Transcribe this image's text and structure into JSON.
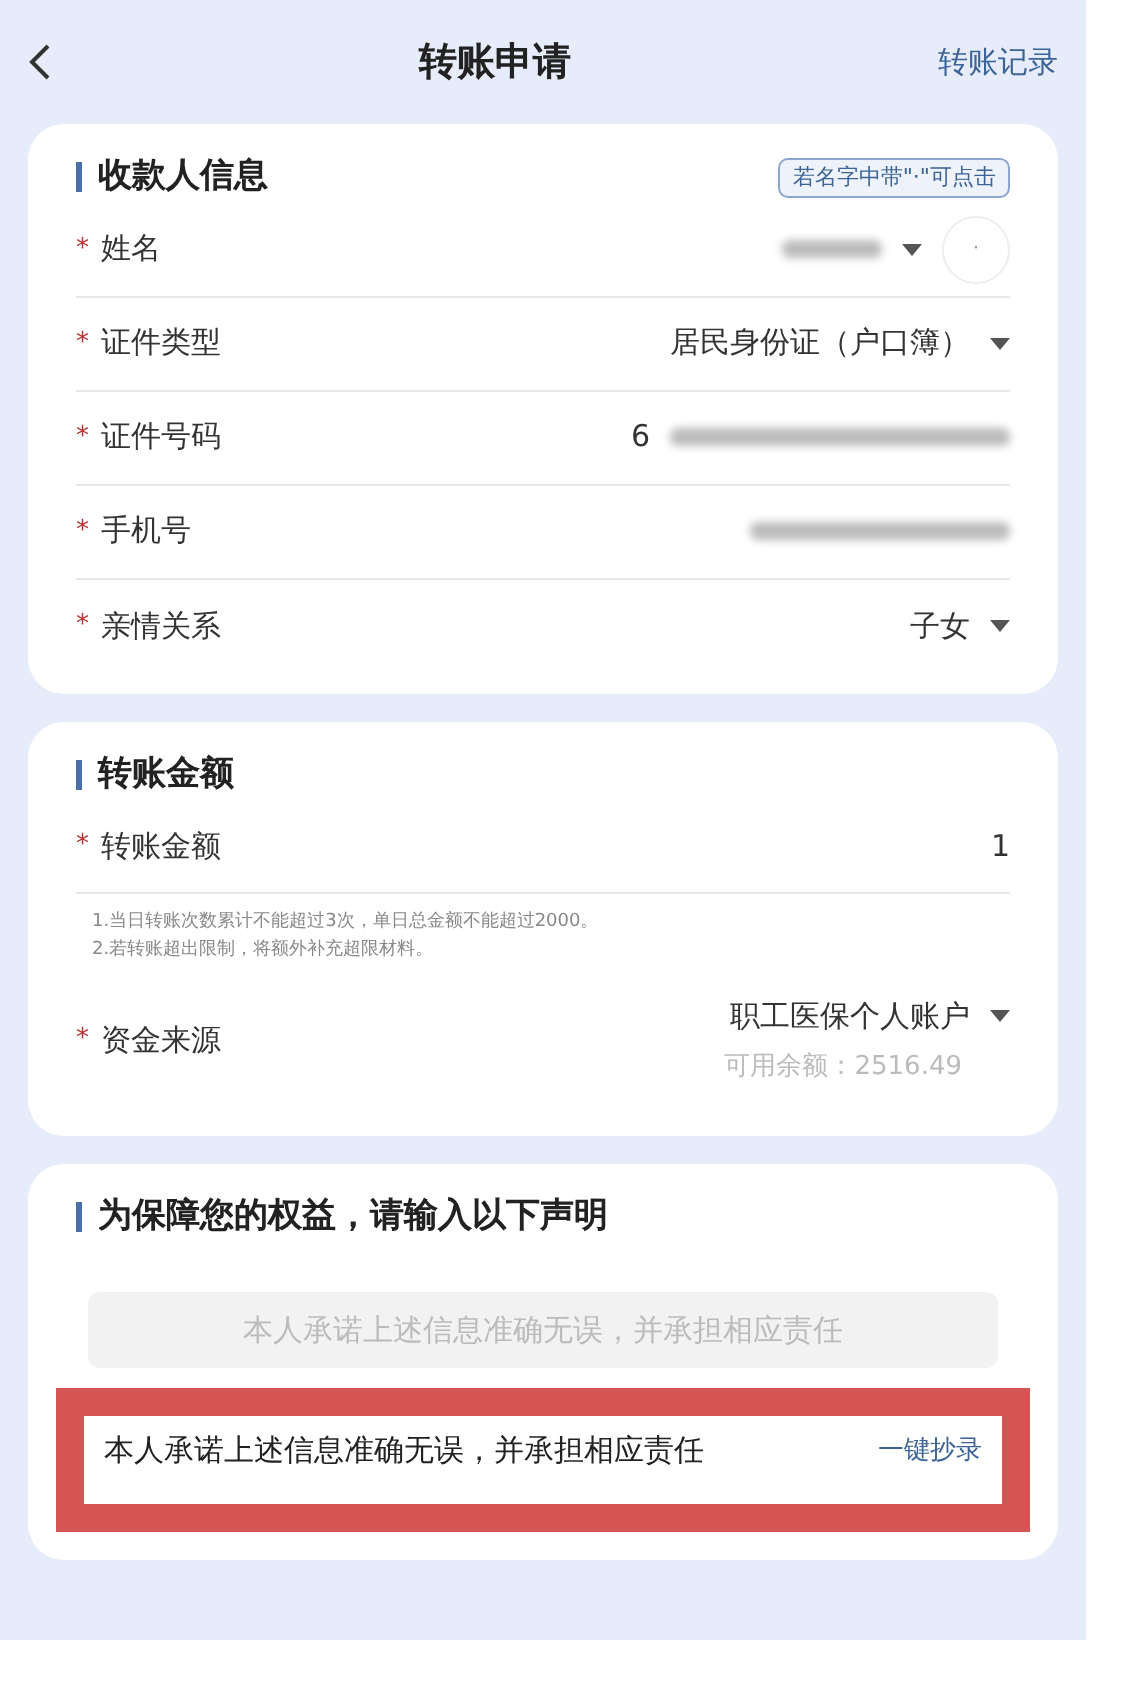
{
  "header": {
    "title": "转账申请",
    "link": "转账记录"
  },
  "recipient": {
    "title": "收款人信息",
    "hint_tag": "若名字中带\"·\"可点击",
    "fields": [
      {
        "kind": "select",
        "required_mark": "*",
        "label": "姓名",
        "redacted": true,
        "dot_button": "·"
      },
      {
        "kind": "select",
        "required_mark": "*",
        "label": "证件类型",
        "value": "居民身份证（户口簿）"
      },
      {
        "kind": "input",
        "required_mark": "*",
        "label": "证件号码",
        "value": "6",
        "redacted": true
      },
      {
        "kind": "input",
        "required_mark": "*",
        "label": "手机号",
        "redacted": true
      },
      {
        "kind": "select",
        "required_mark": "*",
        "label": "亲情关系",
        "value": "子女"
      }
    ]
  },
  "amount": {
    "title": "转账金额",
    "field": {
      "required_mark": "*",
      "label": "转账金额",
      "value": "1"
    },
    "notes": [
      "1.当日转账次数累计不能超过3次，单日总金额不能超过2000。",
      "2.若转账超出限制，将额外补充超限材料。"
    ],
    "source": {
      "required_mark": "*",
      "label": "资金来源",
      "value": "职工医保个人账户",
      "balance": "可用余额：2516.49"
    }
  },
  "declaration": {
    "title": "为保障您的权益，请输入以下声明",
    "prompt": "本人承诺上述信息准确无误，并承担相应责任",
    "value": "本人承诺上述信息准确无误，并承担相应责任",
    "copy_link": "一键抄录",
    "highlighted": true
  }
}
